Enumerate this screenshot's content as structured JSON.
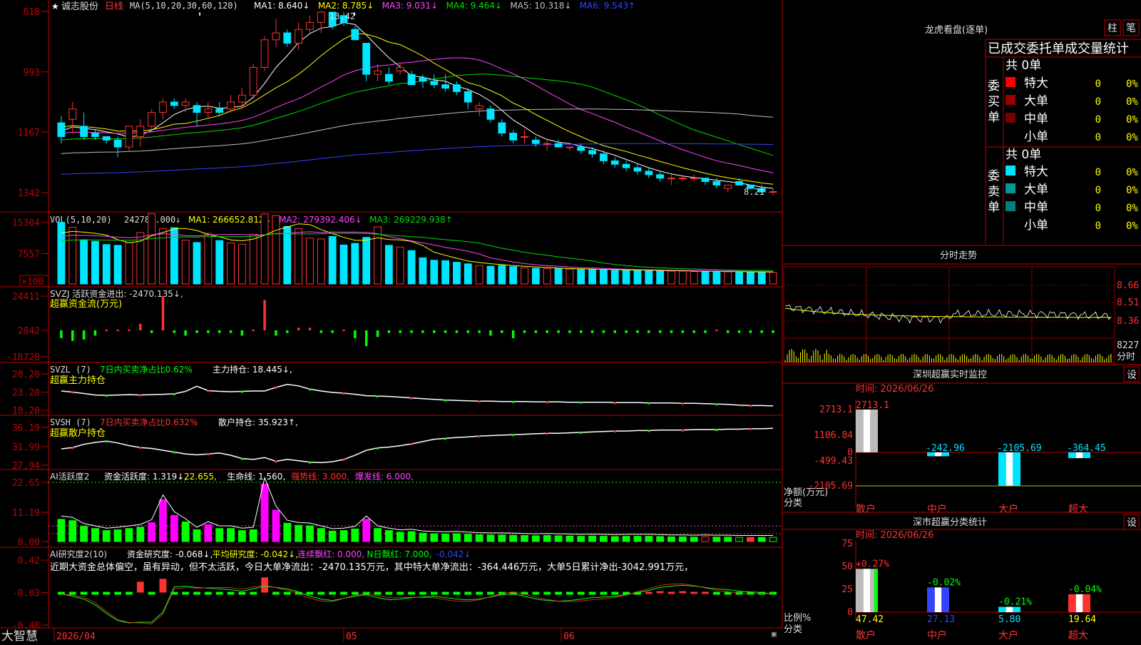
{
  "stock": {
    "star": "★",
    "name": "诚志股份",
    "period": "日线"
  },
  "colors": {
    "up": "#ff3232",
    "down": "#00e5ff",
    "ma1": "#ffffff",
    "ma2": "#ffff00",
    "ma3": "#ff44ff",
    "ma4": "#00dd00",
    "ma5": "#c0c0c0",
    "ma6": "#3344ff",
    "axis": "#c00000",
    "green": "#00ff00"
  },
  "kline": {
    "ma_header": "MA(5,10,20,30,60,120)",
    "ma_items": [
      {
        "label": "MA1: 8.640↓",
        "color": "#ffffff"
      },
      {
        "label": "MA2: 8.785↓",
        "color": "#ffff00"
      },
      {
        "label": "MA3: 9.031↓",
        "color": "#ff44ff"
      },
      {
        "label": "MA4: 9.464↓",
        "color": "#00dd00"
      },
      {
        "label": "MA5: 10.318↓",
        "color": "#c0c0c0"
      },
      {
        "label": "MA6: 9.543↑",
        "color": "#3344ff"
      }
    ],
    "y_ticks": [
      "1342",
      "1167",
      "993",
      "818"
    ],
    "high_label": "13.42",
    "low_label": "8.21"
  },
  "chart_data": [
    {
      "type": "candlestick",
      "title": "日线",
      "dates_visible": [
        "2026/04",
        "05",
        "06"
      ],
      "y_ticks": [
        8.18,
        9.93,
        11.67,
        13.42
      ],
      "max_marker": 13.42,
      "min_marker": 8.21,
      "ohlc": [
        [
          10.2,
          10.4,
          9.6,
          9.8
        ],
        [
          10.3,
          10.8,
          9.9,
          10.6
        ],
        [
          10.1,
          10.5,
          9.7,
          9.8
        ],
        [
          9.9,
          10.0,
          9.7,
          9.8
        ],
        [
          9.8,
          9.8,
          9.6,
          9.7
        ],
        [
          9.7,
          9.8,
          9.2,
          9.5
        ],
        [
          9.5,
          10.0,
          9.4,
          10.1
        ],
        [
          9.8,
          10.3,
          9.5,
          10.1
        ],
        [
          10.1,
          10.6,
          9.9,
          10.5
        ],
        [
          10.5,
          10.9,
          10.3,
          10.8
        ],
        [
          10.8,
          10.9,
          10.6,
          10.7
        ],
        [
          10.7,
          10.9,
          10.5,
          10.8
        ],
        [
          10.7,
          10.8,
          10.1,
          10.5
        ],
        [
          10.5,
          10.8,
          10.3,
          10.6
        ],
        [
          10.6,
          10.8,
          10.4,
          10.5
        ],
        [
          10.6,
          11.0,
          10.5,
          10.8
        ],
        [
          10.8,
          11.2,
          10.6,
          11.0
        ],
        [
          11.0,
          11.9,
          10.9,
          11.8
        ],
        [
          11.8,
          12.7,
          11.7,
          12.6
        ],
        [
          12.6,
          13.2,
          12.4,
          12.8
        ],
        [
          12.8,
          12.9,
          12.4,
          12.5
        ],
        [
          12.5,
          13.1,
          12.3,
          12.9
        ],
        [
          12.9,
          13.3,
          12.8,
          13.1
        ],
        [
          13.1,
          13.42,
          12.8,
          13.4
        ],
        [
          13.4,
          13.4,
          12.9,
          13.0
        ],
        [
          13.3,
          13.4,
          13.0,
          13.1
        ],
        [
          12.9,
          13.0,
          12.6,
          12.6
        ],
        [
          12.5,
          12.5,
          11.4,
          11.6
        ],
        [
          11.6,
          11.9,
          11.4,
          11.7
        ],
        [
          11.6,
          11.8,
          11.3,
          11.4
        ],
        [
          11.7,
          11.9,
          11.6,
          11.8
        ],
        [
          11.6,
          11.7,
          11.3,
          11.3
        ],
        [
          11.5,
          11.6,
          11.2,
          11.4
        ],
        [
          11.4,
          11.6,
          11.2,
          11.3
        ],
        [
          11.3,
          11.6,
          11.1,
          11.2
        ],
        [
          11.3,
          11.4,
          11.0,
          11.1
        ],
        [
          11.1,
          11.2,
          10.6,
          10.8
        ],
        [
          10.6,
          10.8,
          10.4,
          10.7
        ],
        [
          10.6,
          10.7,
          10.2,
          10.3
        ],
        [
          10.2,
          10.3,
          9.8,
          9.9
        ],
        [
          9.9,
          10.0,
          9.6,
          9.7
        ],
        [
          9.8,
          10.0,
          9.6,
          9.8
        ],
        [
          9.7,
          9.8,
          9.5,
          9.6
        ],
        [
          9.6,
          9.7,
          9.4,
          9.6
        ],
        [
          9.6,
          9.7,
          9.5,
          9.5
        ],
        [
          9.5,
          9.5,
          9.4,
          9.5
        ],
        [
          9.5,
          9.6,
          9.3,
          9.4
        ],
        [
          9.4,
          9.5,
          9.2,
          9.3
        ],
        [
          9.3,
          9.4,
          9.0,
          9.1
        ],
        [
          9.1,
          9.2,
          8.9,
          9.0
        ],
        [
          9.0,
          9.1,
          8.8,
          8.9
        ],
        [
          8.9,
          9.0,
          8.7,
          8.8
        ],
        [
          8.8,
          8.9,
          8.6,
          8.7
        ],
        [
          8.7,
          8.8,
          8.5,
          8.6
        ],
        [
          8.6,
          8.7,
          8.4,
          8.6
        ],
        [
          8.6,
          8.7,
          8.5,
          8.6
        ],
        [
          8.6,
          8.7,
          8.5,
          8.6
        ],
        [
          8.6,
          8.6,
          8.4,
          8.5
        ],
        [
          8.5,
          8.6,
          8.3,
          8.4
        ],
        [
          8.3,
          8.4,
          8.2,
          8.4
        ],
        [
          8.5,
          8.6,
          8.4,
          8.4
        ],
        [
          8.4,
          8.4,
          8.3,
          8.3
        ],
        [
          8.3,
          8.4,
          8.2,
          8.2
        ],
        [
          8.2,
          8.3,
          8.1,
          8.21
        ]
      ]
    },
    {
      "type": "bar",
      "title": "VOL(5,10,20)",
      "ylabel": "×100",
      "y_ticks": [
        7557,
        15304
      ],
      "values": [
        15304,
        14100,
        11000,
        10600,
        9800,
        9600,
        10300,
        12800,
        17500,
        13800,
        14000,
        10900,
        10300,
        12600,
        10800,
        10200,
        9900,
        12300,
        17400,
        17000,
        14300,
        13800,
        11400,
        11200,
        11800,
        9700,
        10100,
        11600,
        14200,
        9600,
        9200,
        8300,
        6500,
        5900,
        5800,
        5400,
        5000,
        4600,
        4400,
        4600,
        4300,
        4000,
        3900,
        3800,
        3800,
        3700,
        3600,
        3600,
        3500,
        3400,
        3400,
        3400,
        3300,
        3300,
        3200,
        3200,
        3100,
        3100,
        3100,
        3000,
        3000,
        2900,
        2900,
        2900
      ]
    },
    {
      "type": "bar",
      "title": "SVZJ",
      "y_ticks": [
        -18728,
        2842,
        24411
      ],
      "values": [
        -6000,
        -8000,
        -7000,
        -4000,
        0,
        0,
        0,
        5000,
        -2000,
        26000,
        -2000,
        -4000,
        -2000,
        -2000,
        -2000,
        -2000,
        -4000,
        0,
        23000,
        -4000,
        -2000,
        2000,
        2000,
        -2000,
        -2000,
        0,
        -6000,
        -12000,
        -5000,
        -2000,
        -2000,
        -2000,
        -2000,
        -2000,
        -2000,
        -2000,
        -2000,
        -2000,
        -4000,
        -2000,
        -6000,
        -2000,
        -2000,
        -2000,
        -2000,
        -2000,
        -2000,
        -2000,
        -2000,
        -2000,
        -2000,
        -2000,
        -2000,
        -2000,
        -2000,
        -2000,
        -2000,
        -2000,
        0,
        -2000,
        -2000,
        -2000,
        -2000,
        -2000
      ]
    },
    {
      "type": "line",
      "title": "SVZL (7)",
      "y_ticks": [
        18.2,
        23.2,
        28.2
      ],
      "values": [
        23.5,
        23.2,
        22.8,
        22.4,
        22.3,
        22.4,
        22.5,
        22.4,
        22.5,
        22.6,
        22.7,
        23.4,
        24.8,
        23.6,
        23.4,
        23.3,
        23.4,
        23.5,
        23.5,
        24.5,
        25.3,
        24.9,
        24.0,
        23.5,
        23.1,
        22.9,
        22.6,
        22.2,
        22.1,
        22.0,
        21.8,
        21.6,
        21.4,
        21.2,
        21.0,
        20.9,
        20.8,
        20.7,
        20.7,
        20.6,
        20.6,
        20.6,
        20.5,
        20.5,
        20.5,
        20.4,
        20.4,
        20.4,
        20.4,
        20.3,
        20.3,
        20.3,
        20.2,
        20.2,
        20.2,
        20.1,
        20.1,
        20.0,
        19.9,
        19.8,
        19.6,
        19.5,
        19.5,
        19.4
      ]
    },
    {
      "type": "line",
      "title": "SVSH (7)",
      "y_ticks": [
        27.94,
        31.99,
        36.19
      ],
      "values": [
        31.5,
        31.8,
        32.5,
        32.9,
        33.2,
        32.8,
        32.2,
        31.8,
        31.6,
        31.2,
        30.8,
        30.4,
        30.2,
        30.4,
        30.6,
        30.1,
        29.4,
        29.2,
        29.6,
        28.8,
        29.2,
        28.9,
        28.6,
        28.5,
        28.7,
        29.2,
        30.1,
        31.2,
        31.7,
        31.9,
        32.2,
        32.6,
        33.1,
        33.6,
        33.8,
        34.0,
        34.1,
        34.3,
        34.4,
        34.5,
        34.6,
        34.7,
        34.8,
        34.9,
        34.9,
        35.0,
        35.1,
        35.2,
        35.3,
        35.4,
        35.4,
        35.5,
        35.5,
        35.6,
        35.6,
        35.6,
        35.7,
        35.7,
        35.7,
        35.8,
        35.8,
        35.9,
        35.9,
        36.0
      ]
    },
    {
      "type": "bar",
      "title": "AI活跃度2",
      "y_ticks": [
        0.0,
        11.19,
        22.65
      ],
      "values": [
        8.5,
        8.0,
        5.8,
        5.0,
        4.2,
        4.5,
        5.0,
        5.5,
        7.2,
        16.0,
        10.0,
        7.5,
        4.5,
        6.5,
        5.0,
        5.0,
        4.2,
        4.5,
        22.0,
        12.0,
        7.0,
        6.2,
        6.0,
        5.0,
        4.0,
        4.2,
        4.8,
        8.5,
        5.0,
        4.2,
        3.6,
        3.8,
        3.2,
        3.0,
        2.9,
        3.0,
        2.8,
        2.6,
        2.5,
        2.5,
        2.4,
        2.3,
        2.2,
        2.3,
        2.2,
        2.1,
        2.0,
        2.1,
        2.0,
        1.9,
        2.0,
        2.0,
        2.0,
        1.9,
        1.8,
        1.8,
        1.7,
        1.8,
        1.7,
        1.7,
        1.6,
        1.6,
        1.6,
        1.6
      ]
    },
    {
      "type": "bar",
      "title": "AI研究度2(10)",
      "y_ticks": [
        -0.48,
        -0.03,
        0.42
      ],
      "values": [
        -0.03,
        -0.03,
        -0.03,
        -0.03,
        -0.03,
        -0.03,
        -0.03,
        0.12,
        -0.03,
        0.16,
        -0.03,
        -0.03,
        -0.03,
        -0.03,
        -0.03,
        -0.03,
        -0.03,
        -0.03,
        0.18,
        -0.03,
        -0.03,
        -0.03,
        -0.03,
        -0.03,
        -0.03,
        -0.03,
        -0.03,
        -0.06,
        -0.03,
        -0.03,
        -0.03,
        -0.03,
        -0.03,
        -0.03,
        -0.03,
        -0.03,
        -0.03,
        -0.03,
        -0.03,
        -0.03,
        -0.03,
        -0.03,
        -0.03,
        -0.03,
        -0.03,
        -0.04,
        -0.03,
        -0.03,
        -0.03,
        -0.03,
        -0.03,
        -0.03,
        -0.02,
        -0.01,
        -0.02,
        -0.01,
        -0.02,
        -0.02,
        -0.03,
        -0.03,
        -0.03,
        -0.03,
        -0.03,
        -0.04
      ]
    },
    {
      "type": "bar",
      "title": "深圳超赢实时监控",
      "categories": [
        "散户",
        "中户",
        "大户",
        "超大"
      ],
      "values": [
        2713.1,
        -242.96,
        -2105.69,
        -364.45
      ],
      "y_ticks": [
        2713.1,
        1106.84,
        0,
        -499.43,
        -2105.69
      ],
      "ylabel": "净额(万元)"
    },
    {
      "type": "bar",
      "title": "深市超赢分类统计",
      "categories": [
        "散户",
        "中户",
        "大户",
        "超大"
      ],
      "values": [
        47.42,
        27.13,
        5.8,
        19.64
      ],
      "change": [
        "+0.27%",
        "-0.02%",
        "-0.21%",
        "-0.04%"
      ],
      "y_ticks": [
        0,
        25,
        50,
        75
      ],
      "ylabel": "比例%"
    }
  ],
  "vol": {
    "header": "VOL(5,10,20)",
    "value": "242781.000↓",
    "items": [
      {
        "label": "MA1: 266652.812↓",
        "color": "#ffff00"
      },
      {
        "label": "MA2: 279392.406↓",
        "color": "#ff44ff"
      },
      {
        "label": "MA3: 269229.938↑",
        "color": "#00dd00"
      }
    ],
    "y_ticks": [
      "15304",
      "7557"
    ],
    "unit": "×100"
  },
  "svzj": {
    "line1": "SVZJ  活跃资金进出: -2470.135↓,",
    "line2": "超赢资金流(万元)",
    "y_ticks": [
      "24411",
      "2842",
      "-18728"
    ]
  },
  "svzl": {
    "line1a": "SVZL (7)",
    "line1b": "7日内买卖净占比0.62%",
    "line1c": "主力持仓: 18.445↓,",
    "line2": "超赢主力持仓",
    "y_ticks": [
      "28.20",
      "23.20",
      "18.20"
    ]
  },
  "svsh": {
    "line1a": "SVSH (7)",
    "line1b": "7日内买卖净占比0.632%",
    "line1c": "散户持仓: 35.923↑,",
    "line2": "超赢散户持仓",
    "y_ticks": [
      "36.19",
      "31.99",
      "27.94"
    ]
  },
  "ai1": {
    "title": "AI活跃度2",
    "items": [
      {
        "label": "资金活跃度: 1.319↓,",
        "color": "#ffffff"
      },
      {
        "label": "22.655,",
        "color": "#ffff00"
      },
      {
        "label": "生命线: 1.560,",
        "color": "#ffffff"
      },
      {
        "label": "强势线: 3.000,",
        "color": "#ff3232"
      },
      {
        "label": "爆发线: 6.000,",
        "color": "#ff44ff"
      }
    ],
    "y_ticks": [
      "22.65",
      "11.19",
      "0.00"
    ]
  },
  "ai2": {
    "title": "AI研究度2(10)",
    "items": [
      {
        "label": "资金研究度: -0.068↓,",
        "color": "#ffffff"
      },
      {
        "label": "平均研究度: -0.042↓,",
        "color": "#ffff00"
      },
      {
        "label": "连续飘红: 0.000,",
        "color": "#ff44ff"
      },
      {
        "label": "N日飘红: 7.000,",
        "color": "#00ff00"
      },
      {
        "label": "-0.042↓",
        "color": "#3344ff"
      }
    ],
    "comment": "近期大资金总体偏空，虽有异动，但不太活跃，今日大单净流出：-2470.135万元，其中特大单净流出：-364.446万元，大单5日累计净出-3042.991万元，",
    "y_ticks": [
      "0.42",
      "-0.03",
      "-0.48"
    ]
  },
  "dates": {
    "d1": "2026/04",
    "d2": "05",
    "d3": "06"
  },
  "brand": "大智慧",
  "lhb": {
    "title": "龙虎看盘(逐单)",
    "btn1": "柱",
    "btn2": "笔",
    "subtitle": "已成交委托单成交量统计",
    "buy_label": "委买单",
    "sell_label": "委卖单",
    "buy_total": "共 0单",
    "sell_total": "共 0单",
    "buy_rows": [
      {
        "name": "特大",
        "count": "0",
        "pct": "0%",
        "color": "#ff0000"
      },
      {
        "name": "大单",
        "count": "0",
        "pct": "0%",
        "color": "#990000"
      },
      {
        "name": "中单",
        "count": "0",
        "pct": "0%",
        "color": "#770000"
      },
      {
        "name": "小单",
        "count": "0",
        "pct": "0%",
        "color": ""
      }
    ],
    "sell_rows": [
      {
        "name": "特大",
        "count": "0",
        "pct": "0%",
        "color": "#00e5ff"
      },
      {
        "name": "大单",
        "count": "0",
        "pct": "0%",
        "color": "#009999"
      },
      {
        "name": "中单",
        "count": "0",
        "pct": "0%",
        "color": "#008080"
      },
      {
        "name": "小单",
        "count": "0",
        "pct": "0%",
        "color": ""
      }
    ]
  },
  "intraday": {
    "title": "分时走势",
    "y_ticks": [
      "8.66",
      "8.51",
      "8.36"
    ],
    "vol_label": "8227",
    "unit": "分时"
  },
  "monitor": {
    "title": "深圳超赢实时监控",
    "btn": "设",
    "time": "时间: 2026/06/26",
    "unit1": "净额(万元)",
    "unit2": "分类"
  },
  "classify": {
    "title": "深市超赢分类统计",
    "btn": "设",
    "time": "时间: 2026/06/26",
    "unit1": "比例%",
    "unit2": "分类"
  }
}
